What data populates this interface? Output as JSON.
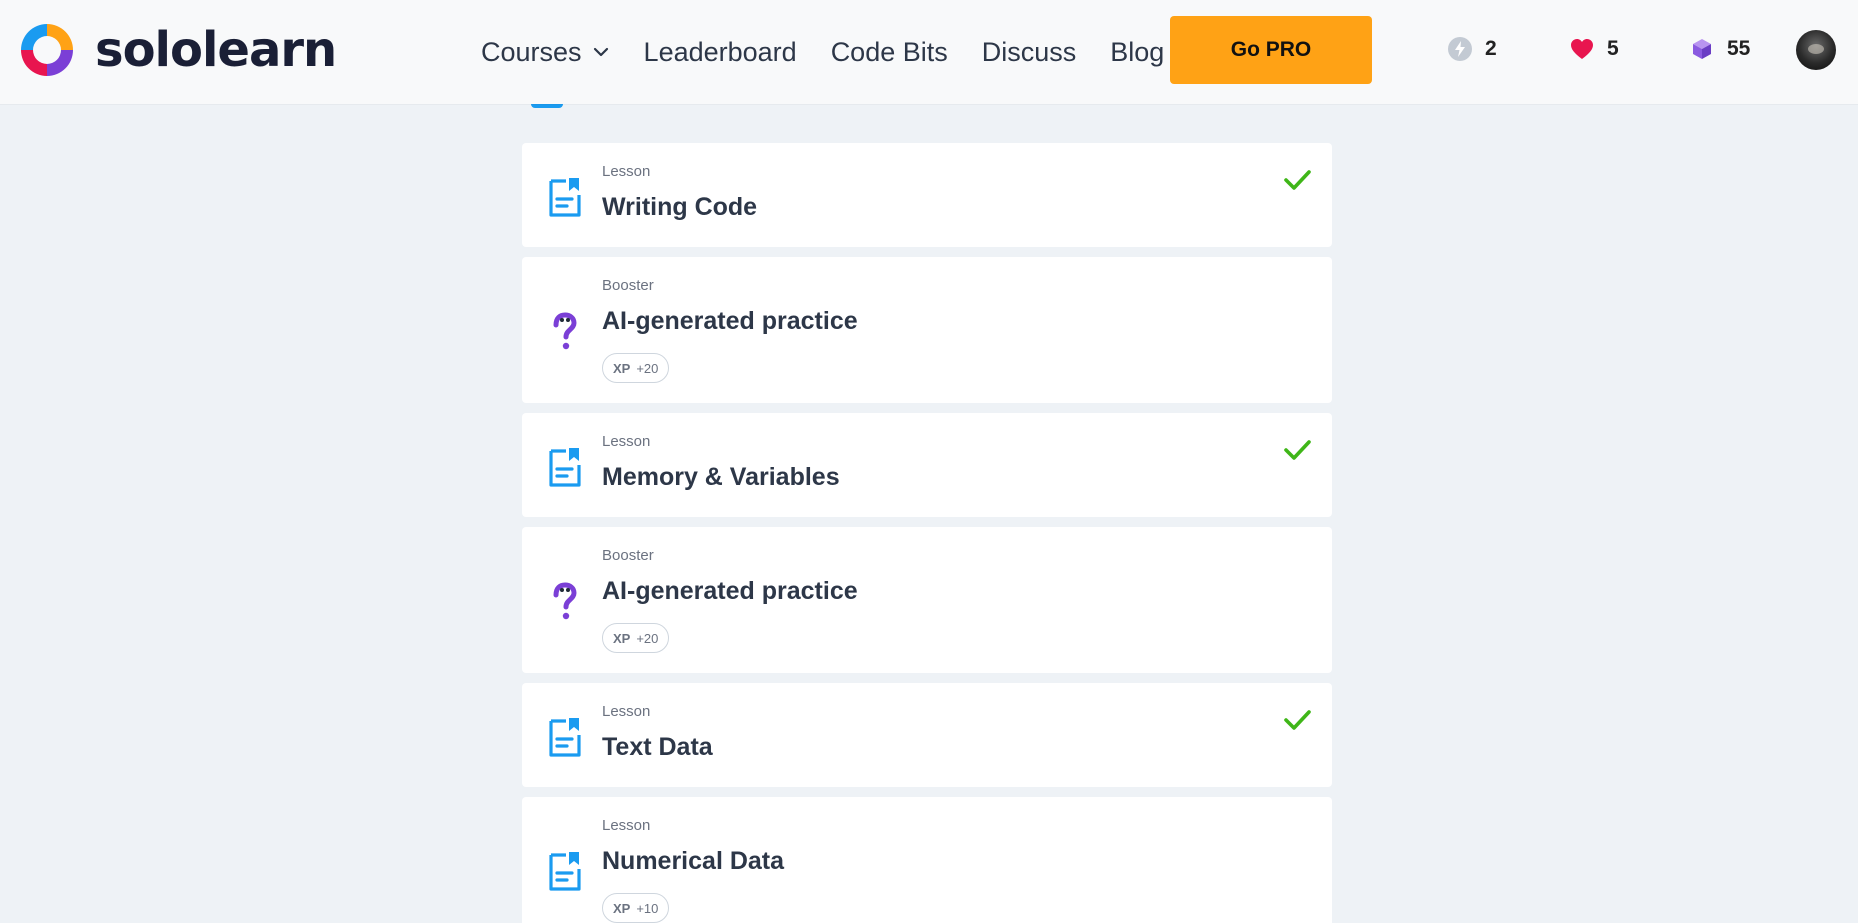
{
  "brand": {
    "name": "sololearn"
  },
  "nav": {
    "courses": "Courses",
    "leaderboard": "Leaderboard",
    "code_bits": "Code Bits",
    "discuss": "Discuss",
    "blog": "Blog",
    "go_pro": "Go PRO"
  },
  "stats": {
    "streak": "2",
    "hearts": "5",
    "gems": "55"
  },
  "colors": {
    "accent_blue": "#1a9bf0",
    "pro_orange": "#ffa215",
    "check_green": "#3fb618",
    "booster_purple": "#7b3fd6",
    "heart_red": "#e8154f"
  },
  "items": [
    {
      "kind": "Lesson",
      "title": "Writing Code",
      "icon": "lesson-icon",
      "completed": true
    },
    {
      "kind": "Booster",
      "title": "AI-generated practice",
      "icon": "booster-icon",
      "xp_label": "XP",
      "xp_value": "+20"
    },
    {
      "kind": "Lesson",
      "title": "Memory & Variables",
      "icon": "lesson-icon",
      "completed": true
    },
    {
      "kind": "Booster",
      "title": "AI-generated practice",
      "icon": "booster-icon",
      "xp_label": "XP",
      "xp_value": "+20"
    },
    {
      "kind": "Lesson",
      "title": "Text Data",
      "icon": "lesson-icon",
      "completed": true
    },
    {
      "kind": "Lesson",
      "title": "Numerical Data",
      "icon": "lesson-icon",
      "xp_label": "XP",
      "xp_value": "+10"
    }
  ]
}
